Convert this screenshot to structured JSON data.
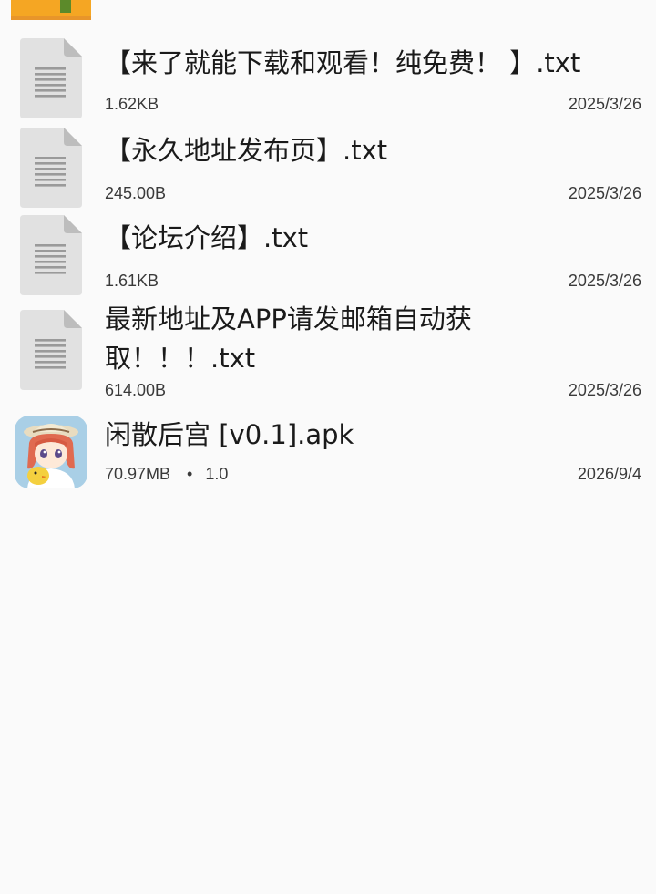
{
  "files": [
    {
      "name": "【来了就能下载和观看！纯免费！ 】.txt",
      "size": "1.62KB",
      "date": "2025/3/26",
      "icon": "text-file-icon"
    },
    {
      "name": "【永久地址发布页】.txt",
      "size": "245.00B",
      "date": "2025/3/26",
      "icon": "text-file-icon"
    },
    {
      "name": "【论坛介绍】.txt",
      "size": "1.61KB",
      "date": "2025/3/26",
      "icon": "text-file-icon"
    },
    {
      "name": "最新地址及APP请发邮箱自动获取！！！.txt",
      "size": "614.00B",
      "date": "2025/3/26",
      "icon": "text-file-icon"
    },
    {
      "name": "闲散后宫 [v0.1].apk",
      "size": "70.97MB",
      "separator": "•",
      "version": "1.0",
      "date": "2026/9/4",
      "icon": "apk-app-icon"
    }
  ],
  "colors": {
    "background": "#fafafa",
    "folder": "#f5a623",
    "file_icon": "#e1e1e1",
    "file_icon_lines": "#9a9a9a"
  }
}
